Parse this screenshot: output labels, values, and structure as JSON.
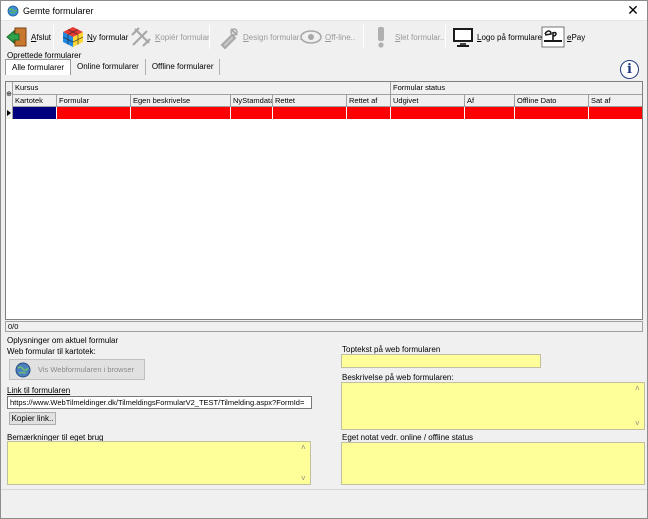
{
  "window": {
    "title": "Gemte formularer",
    "close_glyph": "✕"
  },
  "toolbar": [
    {
      "key": "afslut",
      "mnemonic": "A",
      "rest": "fslut",
      "icon": "exit-door-icon",
      "enabled": true
    },
    {
      "key": "ny",
      "mnemonic": "N",
      "rest": "y formular",
      "icon": "rubiks-cube-icon",
      "enabled": true
    },
    {
      "key": "kopier",
      "mnemonic": "K",
      "rest": "opiér formular",
      "icon": "copy-tools-icon",
      "enabled": false
    },
    {
      "key": "design",
      "mnemonic": "D",
      "rest": "esign formular..",
      "icon": "design-tools-icon",
      "enabled": false
    },
    {
      "key": "offline",
      "mnemonic": "O",
      "rest": "ff-line..",
      "icon": "eye-icon",
      "enabled": false
    },
    {
      "key": "slet",
      "mnemonic": "S",
      "rest": "let formular..",
      "icon": "exclamation-icon",
      "enabled": false
    },
    {
      "key": "logo",
      "mnemonic": "L",
      "rest": "ogo på formularer",
      "icon": "monitor-icon",
      "enabled": true
    },
    {
      "key": "epay",
      "mnemonic": "e",
      "rest": "Pay",
      "icon": "epay-logo-icon",
      "enabled": true
    }
  ],
  "sections": {
    "oprettede": "Oprettede formularer",
    "oplysninger": "Oplysninger om aktuel formular"
  },
  "tabs": [
    {
      "label": "Alle formularer",
      "active": true
    },
    {
      "label": "Online formularer",
      "active": false
    },
    {
      "label": "Offline formularer",
      "active": false
    }
  ],
  "info_glyph": "i",
  "grid": {
    "group_headers": [
      "Kursus",
      "Formular status"
    ],
    "columns": [
      "Kartotek",
      "Formular",
      "Egen beskrivelse",
      "NyStamdata",
      "Rettet",
      "Rettet af",
      "Udgivet",
      "Af",
      "Offline Dato",
      "Sat af"
    ],
    "row_color": "#ff0000",
    "first_cell_color": "#00007f",
    "corner_glyph": "⊕"
  },
  "status": {
    "record_count": "0/0"
  },
  "left_panel": {
    "web_formular_label": "Web formular til kartotek:",
    "web_button_label": "Vis Webformularen i browser",
    "link_label": "Link til formularen",
    "link_value": "https://www.WebTilmeldinger.dk/TilmeldingsFormularV2_TEST/Tilmelding.aspx?FormId=",
    "copy_link_button": "Kopier link..",
    "remarks_label": "Bemærkninger til eget brug",
    "remarks_value": ""
  },
  "right_panel": {
    "toptekst_label": "Toptekst på web formularen",
    "toptekst_value": "",
    "beskrivelse_label": "Beskrivelse på web formularen:",
    "beskrivelse_value": "",
    "notat_label": "Eget notat vedr. online / offline status",
    "notat_value": ""
  },
  "colors": {
    "field_yellow": "#ffff99",
    "grid_red": "#ff0000"
  }
}
